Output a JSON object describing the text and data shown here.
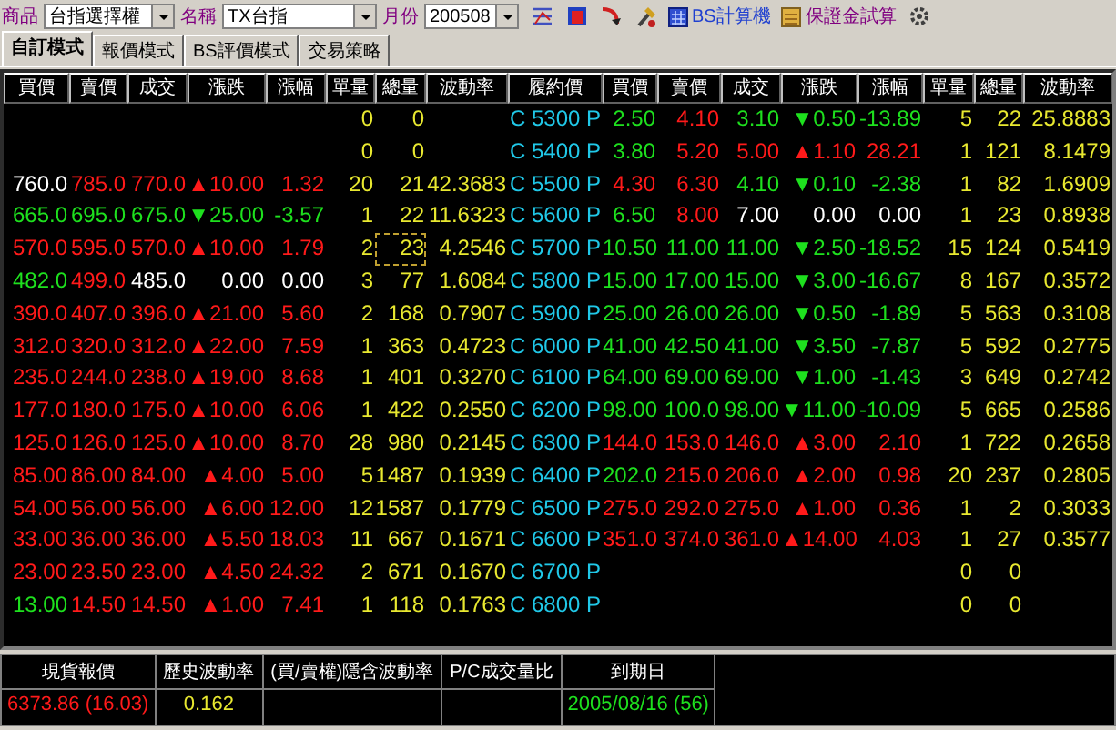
{
  "toolbar": {
    "product_label": "商品",
    "product": "台指選擇權",
    "name_label": "名稱",
    "name": "TX台指",
    "month_label": "月份",
    "month": "200508",
    "links": [
      "BS計算機",
      "保證金試算"
    ]
  },
  "tabs": [
    {
      "label": "自訂模式",
      "selected": true
    },
    {
      "label": "報價模式",
      "selected": false
    },
    {
      "label": "BS評價模式",
      "selected": false
    },
    {
      "label": "交易策略",
      "selected": false
    }
  ],
  "columns": [
    "買價",
    "賣價",
    "成交",
    "漲跌",
    "漲幅",
    "單量",
    "總量",
    "波動率",
    "履約價",
    "買價",
    "賣價",
    "成交",
    "漲跌",
    "漲幅",
    "單量",
    "總量",
    "波動率"
  ],
  "rows": [
    {
      "strike": "C 5300 P",
      "call": {
        "vol": "0",
        "total": "0"
      },
      "put": {
        "bid": {
          "text": "2.50",
          "kind": "down"
        },
        "ask": {
          "text": "4.10",
          "kind": "up"
        },
        "last": {
          "text": "3.10",
          "kind": "down"
        },
        "change": {
          "text": "▼0.50",
          "kind": "down"
        },
        "pct": {
          "text": "-13.89",
          "kind": "down"
        },
        "vol": "5",
        "total": "22",
        "iv": "25.8883"
      }
    },
    {
      "strike": "C 5400 P",
      "call": {
        "vol": "0",
        "total": "0"
      },
      "put": {
        "bid": {
          "text": "3.80",
          "kind": "down"
        },
        "ask": {
          "text": "5.20",
          "kind": "up"
        },
        "last": {
          "text": "5.00",
          "kind": "up"
        },
        "change": {
          "text": "▲1.10",
          "kind": "up"
        },
        "pct": {
          "text": "28.21",
          "kind": "up"
        },
        "vol": "1",
        "total": "121",
        "iv": "8.1479"
      }
    },
    {
      "strike": "C 5500 P",
      "call": {
        "bid": {
          "text": "760.0",
          "kind": "flat"
        },
        "ask": {
          "text": "785.0",
          "kind": "up"
        },
        "last": {
          "text": "770.0",
          "kind": "up"
        },
        "change": {
          "text": "▲10.00",
          "kind": "up"
        },
        "pct": {
          "text": "1.32",
          "kind": "up"
        },
        "vol": "20",
        "total": "21",
        "iv": "42.3683"
      },
      "put": {
        "bid": {
          "text": "4.30",
          "kind": "up"
        },
        "ask": {
          "text": "6.30",
          "kind": "up"
        },
        "last": {
          "text": "4.10",
          "kind": "down"
        },
        "change": {
          "text": "▼0.10",
          "kind": "down"
        },
        "pct": {
          "text": "-2.38",
          "kind": "down"
        },
        "vol": "1",
        "total": "82",
        "iv": "1.6909"
      }
    },
    {
      "strike": "C 5600 P",
      "call": {
        "bid": {
          "text": "665.0",
          "kind": "down"
        },
        "ask": {
          "text": "695.0",
          "kind": "down"
        },
        "last": {
          "text": "675.0",
          "kind": "down"
        },
        "change": {
          "text": "▼25.00",
          "kind": "down"
        },
        "pct": {
          "text": "-3.57",
          "kind": "down"
        },
        "vol": "1",
        "total": "22",
        "iv": "11.6323"
      },
      "put": {
        "bid": {
          "text": "6.50",
          "kind": "down"
        },
        "ask": {
          "text": "8.00",
          "kind": "up"
        },
        "last": {
          "text": "7.00",
          "kind": "flat"
        },
        "change": {
          "text": "0.00",
          "kind": "flat"
        },
        "pct": {
          "text": "0.00",
          "kind": "flat"
        },
        "vol": "1",
        "total": "23",
        "iv": "0.8938"
      }
    },
    {
      "strike": "C 5700 P",
      "call": {
        "bid": {
          "text": "570.0",
          "kind": "up"
        },
        "ask": {
          "text": "595.0",
          "kind": "up"
        },
        "last": {
          "text": "570.0",
          "kind": "up"
        },
        "change": {
          "text": "▲10.00",
          "kind": "up"
        },
        "pct": {
          "text": "1.79",
          "kind": "up"
        },
        "vol": "2",
        "total": "23",
        "iv": "4.2546",
        "total_focused": true
      },
      "put": {
        "bid": {
          "text": "10.50",
          "kind": "down"
        },
        "ask": {
          "text": "11.00",
          "kind": "down"
        },
        "last": {
          "text": "11.00",
          "kind": "down"
        },
        "change": {
          "text": "▼2.50",
          "kind": "down"
        },
        "pct": {
          "text": "-18.52",
          "kind": "down"
        },
        "vol": "15",
        "total": "124",
        "iv": "0.5419"
      }
    },
    {
      "strike": "C 5800 P",
      "call": {
        "bid": {
          "text": "482.0",
          "kind": "down"
        },
        "ask": {
          "text": "499.0",
          "kind": "up"
        },
        "last": {
          "text": "485.0",
          "kind": "flat"
        },
        "change": {
          "text": "0.00",
          "kind": "flat"
        },
        "pct": {
          "text": "0.00",
          "kind": "flat"
        },
        "vol": "3",
        "total": "77",
        "iv": "1.6084"
      },
      "put": {
        "bid": {
          "text": "15.00",
          "kind": "down"
        },
        "ask": {
          "text": "17.00",
          "kind": "down"
        },
        "last": {
          "text": "15.00",
          "kind": "down"
        },
        "change": {
          "text": "▼3.00",
          "kind": "down"
        },
        "pct": {
          "text": "-16.67",
          "kind": "down"
        },
        "vol": "8",
        "total": "167",
        "iv": "0.3572"
      }
    },
    {
      "strike": "C 5900 P",
      "call": {
        "bid": {
          "text": "390.0",
          "kind": "up"
        },
        "ask": {
          "text": "407.0",
          "kind": "up"
        },
        "last": {
          "text": "396.0",
          "kind": "up"
        },
        "change": {
          "text": "▲21.00",
          "kind": "up"
        },
        "pct": {
          "text": "5.60",
          "kind": "up"
        },
        "vol": "2",
        "total": "168",
        "iv": "0.7907"
      },
      "put": {
        "bid": {
          "text": "25.00",
          "kind": "down"
        },
        "ask": {
          "text": "26.00",
          "kind": "down"
        },
        "last": {
          "text": "26.00",
          "kind": "down"
        },
        "change": {
          "text": "▼0.50",
          "kind": "down"
        },
        "pct": {
          "text": "-1.89",
          "kind": "down"
        },
        "vol": "5",
        "total": "563",
        "iv": "0.3108"
      }
    },
    {
      "strike": "C 6000 P",
      "call": {
        "bid": {
          "text": "312.0",
          "kind": "up"
        },
        "ask": {
          "text": "320.0",
          "kind": "up"
        },
        "last": {
          "text": "312.0",
          "kind": "up"
        },
        "change": {
          "text": "▲22.00",
          "kind": "up"
        },
        "pct": {
          "text": "7.59",
          "kind": "up"
        },
        "vol": "1",
        "total": "363",
        "iv": "0.4723"
      },
      "put": {
        "bid": {
          "text": "41.00",
          "kind": "down"
        },
        "ask": {
          "text": "42.50",
          "kind": "down"
        },
        "last": {
          "text": "41.00",
          "kind": "down"
        },
        "change": {
          "text": "▼3.50",
          "kind": "down"
        },
        "pct": {
          "text": "-7.87",
          "kind": "down"
        },
        "vol": "5",
        "total": "592",
        "iv": "0.2775"
      }
    },
    {
      "strike": "C 6100 P",
      "call": {
        "bid": {
          "text": "235.0",
          "kind": "up"
        },
        "ask": {
          "text": "244.0",
          "kind": "up"
        },
        "last": {
          "text": "238.0",
          "kind": "up"
        },
        "change": {
          "text": "▲19.00",
          "kind": "up"
        },
        "pct": {
          "text": "8.68",
          "kind": "up"
        },
        "vol": "1",
        "total": "401",
        "iv": "0.3270"
      },
      "put": {
        "bid": {
          "text": "64.00",
          "kind": "down"
        },
        "ask": {
          "text": "69.00",
          "kind": "down"
        },
        "last": {
          "text": "69.00",
          "kind": "down"
        },
        "change": {
          "text": "▼1.00",
          "kind": "down"
        },
        "pct": {
          "text": "-1.43",
          "kind": "down"
        },
        "vol": "3",
        "total": "649",
        "iv": "0.2742"
      }
    },
    {
      "strike": "C 6200 P",
      "call": {
        "bid": {
          "text": "177.0",
          "kind": "up"
        },
        "ask": {
          "text": "180.0",
          "kind": "up"
        },
        "last": {
          "text": "175.0",
          "kind": "up"
        },
        "change": {
          "text": "▲10.00",
          "kind": "up"
        },
        "pct": {
          "text": "6.06",
          "kind": "up"
        },
        "vol": "1",
        "total": "422",
        "iv": "0.2550"
      },
      "put": {
        "bid": {
          "text": "98.00",
          "kind": "down"
        },
        "ask": {
          "text": "100.0",
          "kind": "down"
        },
        "last": {
          "text": "98.00",
          "kind": "down"
        },
        "change": {
          "text": "▼11.00",
          "kind": "down"
        },
        "pct": {
          "text": "-10.09",
          "kind": "down"
        },
        "vol": "5",
        "total": "665",
        "iv": "0.2586"
      }
    },
    {
      "strike": "C 6300 P",
      "call": {
        "bid": {
          "text": "125.0",
          "kind": "up"
        },
        "ask": {
          "text": "126.0",
          "kind": "up"
        },
        "last": {
          "text": "125.0",
          "kind": "up"
        },
        "change": {
          "text": "▲10.00",
          "kind": "up"
        },
        "pct": {
          "text": "8.70",
          "kind": "up"
        },
        "vol": "28",
        "total": "980",
        "iv": "0.2145"
      },
      "put": {
        "bid": {
          "text": "144.0",
          "kind": "up"
        },
        "ask": {
          "text": "153.0",
          "kind": "up"
        },
        "last": {
          "text": "146.0",
          "kind": "up"
        },
        "change": {
          "text": "▲3.00",
          "kind": "up"
        },
        "pct": {
          "text": "2.10",
          "kind": "up"
        },
        "vol": "1",
        "total": "722",
        "iv": "0.2658"
      }
    },
    {
      "strike": "C 6400 P",
      "call": {
        "bid": {
          "text": "85.00",
          "kind": "up"
        },
        "ask": {
          "text": "86.00",
          "kind": "up"
        },
        "last": {
          "text": "84.00",
          "kind": "up"
        },
        "change": {
          "text": "▲4.00",
          "kind": "up"
        },
        "pct": {
          "text": "5.00",
          "kind": "up"
        },
        "vol": "5",
        "total": "1487",
        "iv": "0.1939"
      },
      "put": {
        "bid": {
          "text": "202.0",
          "kind": "down"
        },
        "ask": {
          "text": "215.0",
          "kind": "up"
        },
        "last": {
          "text": "206.0",
          "kind": "up"
        },
        "change": {
          "text": "▲2.00",
          "kind": "up"
        },
        "pct": {
          "text": "0.98",
          "kind": "up"
        },
        "vol": "20",
        "total": "237",
        "iv": "0.2805"
      }
    },
    {
      "strike": "C 6500 P",
      "call": {
        "bid": {
          "text": "54.00",
          "kind": "up"
        },
        "ask": {
          "text": "56.00",
          "kind": "up"
        },
        "last": {
          "text": "56.00",
          "kind": "up"
        },
        "change": {
          "text": "▲6.00",
          "kind": "up"
        },
        "pct": {
          "text": "12.00",
          "kind": "up"
        },
        "vol": "12",
        "total": "1587",
        "iv": "0.1779"
      },
      "put": {
        "bid": {
          "text": "275.0",
          "kind": "up"
        },
        "ask": {
          "text": "292.0",
          "kind": "up"
        },
        "last": {
          "text": "275.0",
          "kind": "up"
        },
        "change": {
          "text": "▲1.00",
          "kind": "up"
        },
        "pct": {
          "text": "0.36",
          "kind": "up"
        },
        "vol": "1",
        "total": "2",
        "iv": "0.3033"
      }
    },
    {
      "strike": "C 6600 P",
      "call": {
        "bid": {
          "text": "33.00",
          "kind": "up"
        },
        "ask": {
          "text": "36.00",
          "kind": "up"
        },
        "last": {
          "text": "36.00",
          "kind": "up"
        },
        "change": {
          "text": "▲5.50",
          "kind": "up"
        },
        "pct": {
          "text": "18.03",
          "kind": "up"
        },
        "vol": "11",
        "total": "667",
        "iv": "0.1671"
      },
      "put": {
        "bid": {
          "text": "351.0",
          "kind": "up"
        },
        "ask": {
          "text": "374.0",
          "kind": "up"
        },
        "last": {
          "text": "361.0",
          "kind": "up"
        },
        "change": {
          "text": "▲14.00",
          "kind": "up"
        },
        "pct": {
          "text": "4.03",
          "kind": "up"
        },
        "vol": "1",
        "total": "27",
        "iv": "0.3577"
      }
    },
    {
      "strike": "C 6700 P",
      "call": {
        "bid": {
          "text": "23.00",
          "kind": "up"
        },
        "ask": {
          "text": "23.50",
          "kind": "up"
        },
        "last": {
          "text": "23.00",
          "kind": "up"
        },
        "change": {
          "text": "▲4.50",
          "kind": "up"
        },
        "pct": {
          "text": "24.32",
          "kind": "up"
        },
        "vol": "2",
        "total": "671",
        "iv": "0.1670"
      },
      "put": {
        "vol": "0",
        "total": "0"
      }
    },
    {
      "strike": "C 6800 P",
      "call": {
        "bid": {
          "text": "13.00",
          "kind": "down"
        },
        "ask": {
          "text": "14.50",
          "kind": "up"
        },
        "last": {
          "text": "14.50",
          "kind": "up"
        },
        "change": {
          "text": "▲1.00",
          "kind": "up"
        },
        "pct": {
          "text": "7.41",
          "kind": "up"
        },
        "vol": "1",
        "total": "118",
        "iv": "0.1763"
      },
      "put": {
        "vol": "0",
        "total": "0"
      }
    }
  ],
  "summary": [
    {
      "header": "現貨報價",
      "value": "6373.86 (16.03)",
      "kind": "up"
    },
    {
      "header": "歷史波動率",
      "value": "0.162",
      "kind": "neutral"
    },
    {
      "header": "(買/賣權)隱含波動率"
    },
    {
      "header": "P/C成交量比"
    },
    {
      "header": "到期日",
      "value": "2005/08/16 (56)",
      "kind": "down"
    }
  ]
}
